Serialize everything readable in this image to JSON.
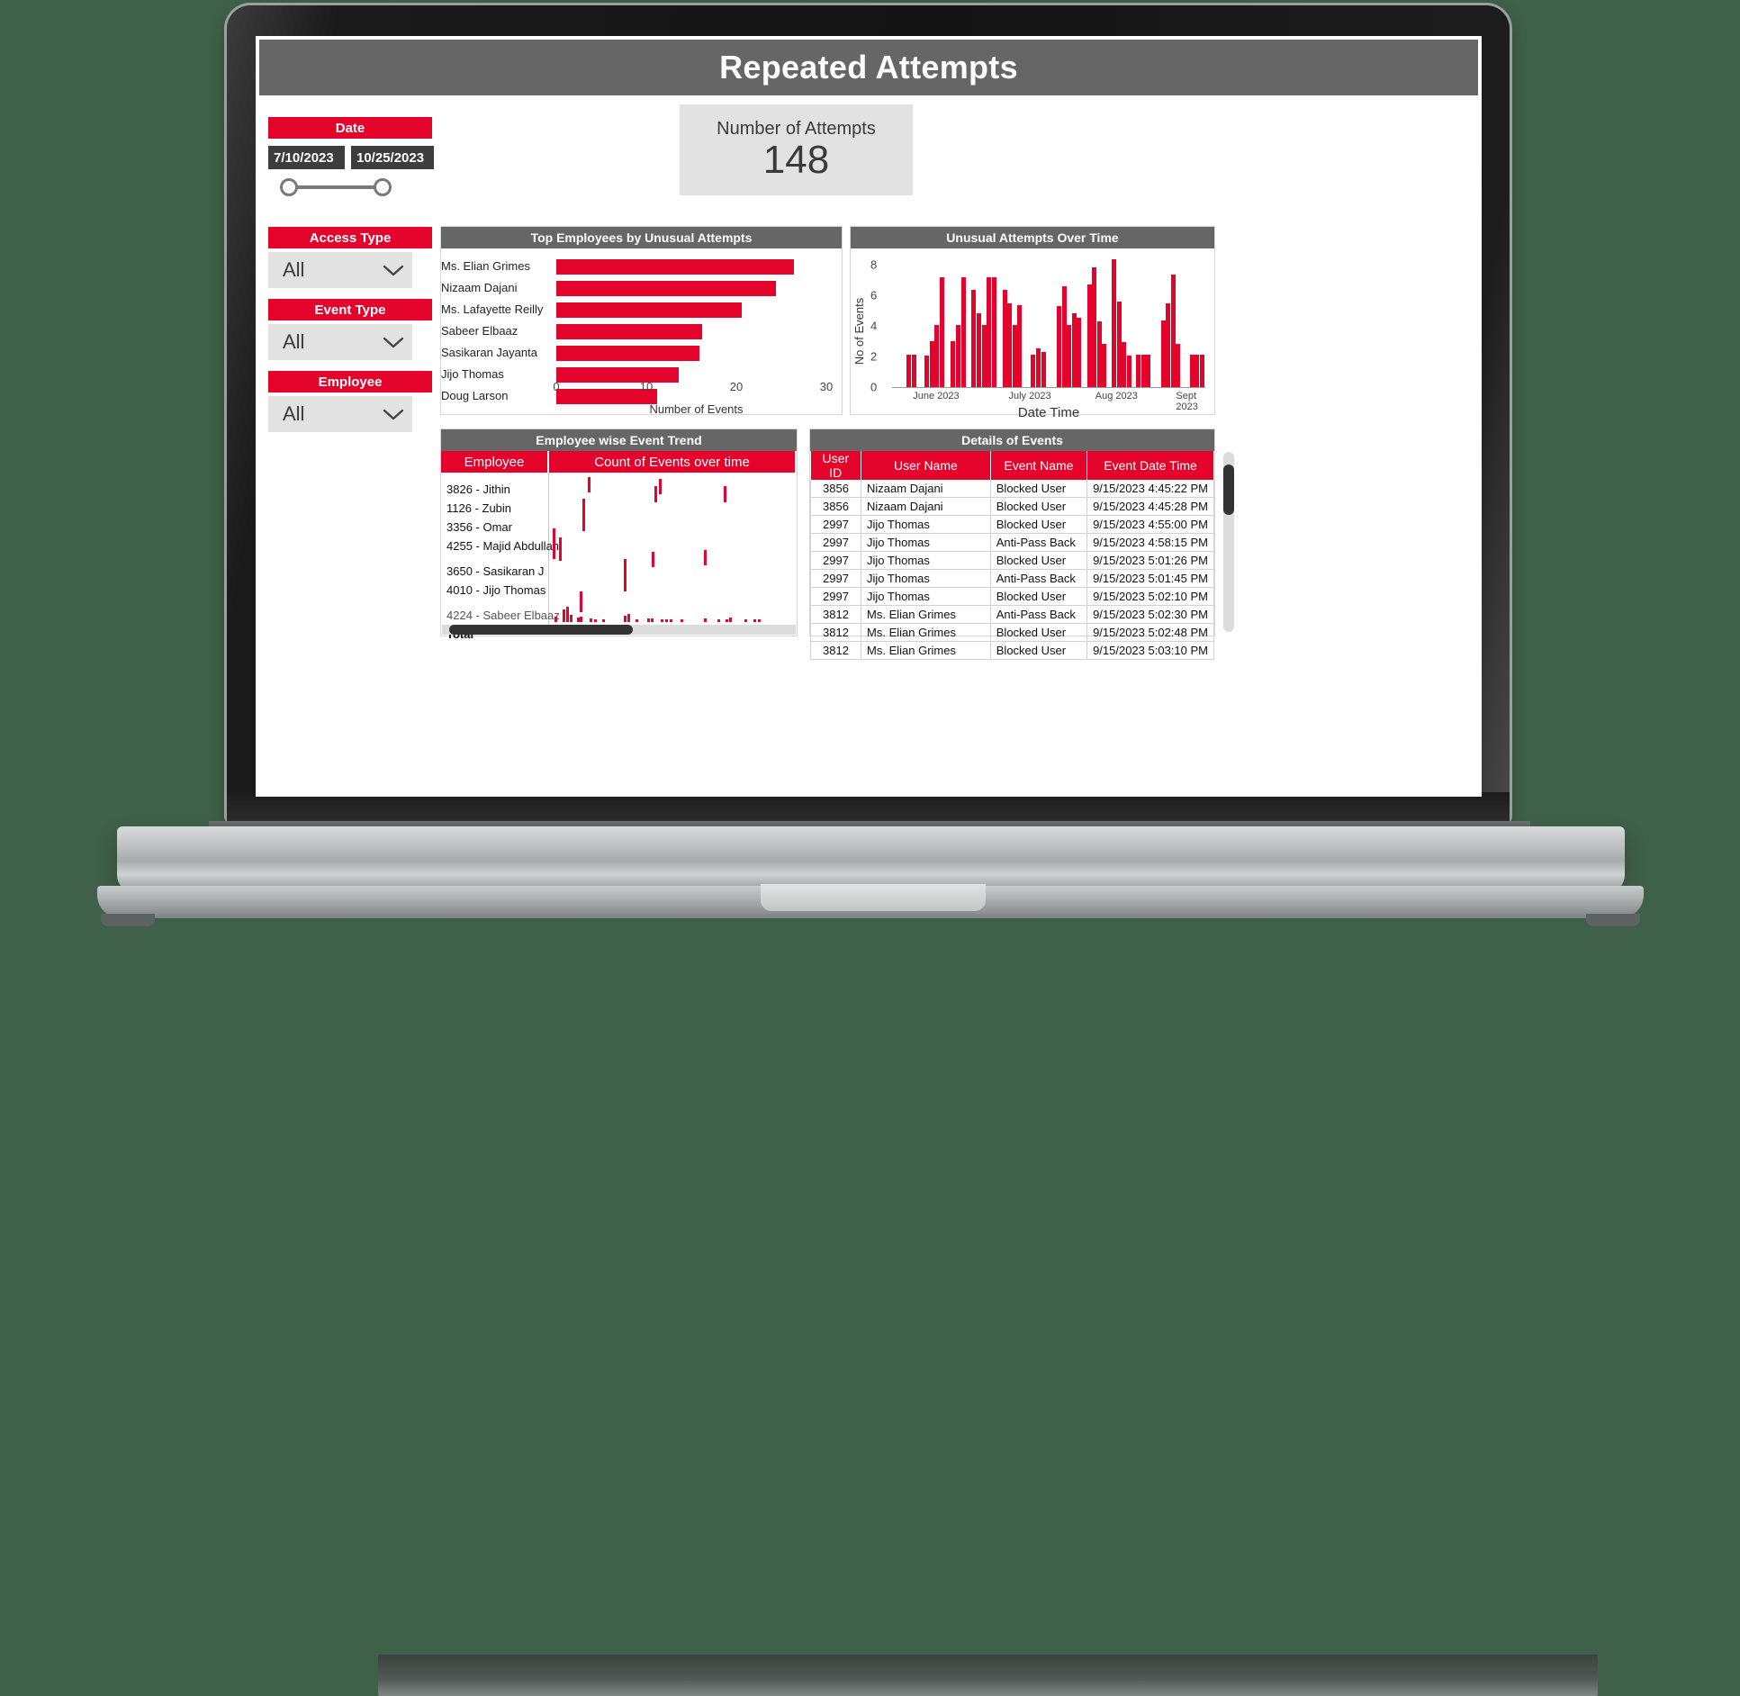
{
  "report": {
    "title": "Repeated Attempts",
    "header_bg": "#666666",
    "accent": "#E4032B"
  },
  "slicers": {
    "date": {
      "label": "Date",
      "start": "7/10/2023",
      "end": "10/25/2023",
      "start_icon": "calendar-icon",
      "end_icon": "calendar-icon"
    },
    "access_type": {
      "label": "Access Type",
      "value": "All",
      "icon": "chevron-down-icon"
    },
    "event_type": {
      "label": "Event Type",
      "value": "All",
      "icon": "chevron-down-icon"
    },
    "employee": {
      "label": "Employee",
      "value": "All",
      "icon": "chevron-down-icon"
    }
  },
  "kpi": {
    "label": "Number of Attempts",
    "value": "148"
  },
  "panels": {
    "top_employees": "Top Employees by Unusual Attempts",
    "over_time": "Unusual Attempts Over Time",
    "employee_trend": "Employee wise Event Trend",
    "details": "Details of Events"
  },
  "chart_data": [
    {
      "type": "bar",
      "orientation": "horizontal",
      "title": "Top Employees by Unusual Attempts",
      "xlabel": "Number of Events",
      "ylabel": "",
      "xlim": [
        0,
        30
      ],
      "xticks": [
        0,
        10,
        20,
        30
      ],
      "grid": false,
      "categories": [
        "Ms. Elian Grimes",
        "Nizaam Dajani",
        "Ms. Lafayette Reilly",
        "Sabeer Elbaaz",
        "Sasikaran Jayanta",
        "Jijo Thomas",
        "Doug Larson"
      ],
      "values": [
        26.4,
        24.4,
        20.6,
        16.2,
        15.9,
        13.6,
        11.2
      ],
      "color": "#E4032B"
    },
    {
      "type": "bar",
      "orientation": "vertical",
      "title": "Unusual Attempts Over Time",
      "xlabel": "Date Time",
      "ylabel": "No of Events",
      "ylim": [
        0,
        8.6
      ],
      "yticks": [
        0,
        2,
        4,
        6,
        8
      ],
      "xticks": [
        "June 2023",
        "July 2023",
        "Aug 2023",
        "Sept 2023"
      ],
      "xtick_positions": [
        0.07,
        0.39,
        0.68,
        0.95
      ],
      "grid": false,
      "color": "#E4032B",
      "values": [
        {
          "x": 0.055,
          "y": 2.1
        },
        {
          "x": 0.075,
          "y": 2.1
        },
        {
          "x": 0.125,
          "y": 2.05
        },
        {
          "x": 0.145,
          "y": 3.0
        },
        {
          "x": 0.163,
          "y": 4.05
        },
        {
          "x": 0.183,
          "y": 7.2
        },
        {
          "x": 0.225,
          "y": 3.0
        },
        {
          "x": 0.245,
          "y": 4.05
        },
        {
          "x": 0.265,
          "y": 7.2
        },
        {
          "x": 0.305,
          "y": 6.35
        },
        {
          "x": 0.325,
          "y": 4.85
        },
        {
          "x": 0.345,
          "y": 4.05
        },
        {
          "x": 0.363,
          "y": 7.2
        },
        {
          "x": 0.382,
          "y": 7.2
        },
        {
          "x": 0.423,
          "y": 6.35
        },
        {
          "x": 0.443,
          "y": 5.45
        },
        {
          "x": 0.462,
          "y": 4.05
        },
        {
          "x": 0.481,
          "y": 5.35
        },
        {
          "x": 0.531,
          "y": 2.1
        },
        {
          "x": 0.551,
          "y": 2.55
        },
        {
          "x": 0.571,
          "y": 2.3
        },
        {
          "x": 0.631,
          "y": 5.3
        },
        {
          "x": 0.65,
          "y": 6.6
        },
        {
          "x": 0.669,
          "y": 4.05
        },
        {
          "x": 0.688,
          "y": 4.85
        },
        {
          "x": 0.707,
          "y": 4.55
        },
        {
          "x": 0.747,
          "y": 6.7
        },
        {
          "x": 0.766,
          "y": 7.85
        },
        {
          "x": 0.785,
          "y": 4.3
        },
        {
          "x": 0.804,
          "y": 2.8
        },
        {
          "x": 0.843,
          "y": 8.35
        },
        {
          "x": 0.862,
          "y": 5.6
        },
        {
          "x": 0.881,
          "y": 2.95
        },
        {
          "x": 0.9,
          "y": 2.05
        },
        {
          "x": 0.936,
          "y": 2.15
        },
        {
          "x": 0.955,
          "y": 2.15
        },
        {
          "x": 0.974,
          "y": 2.15
        },
        {
          "x": 1.03,
          "y": 4.35
        },
        {
          "x": 1.049,
          "y": 5.45
        },
        {
          "x": 1.068,
          "y": 7.35
        },
        {
          "x": 1.087,
          "y": 2.8
        },
        {
          "x": 1.14,
          "y": 2.15
        },
        {
          "x": 1.159,
          "y": 2.15
        },
        {
          "x": 1.178,
          "y": 2.15
        }
      ]
    },
    {
      "type": "table",
      "title": "Employee wise Event Trend",
      "columns": [
        "Employee",
        "Count of Events over time"
      ],
      "rows": [
        "3826 - Jithin",
        "1126 - Zubin",
        "3356 - Omar",
        "4255 - Majid Abdullah",
        "3650 - Sasikaran J",
        "4010 - Jijo Thomas",
        "4224 - Sabeer Elbaaz",
        "Total"
      ],
      "sparklines": [
        {
          "x": 0.155,
          "y": 0.03,
          "h": 0.1
        },
        {
          "x": 0.445,
          "y": 0.04,
          "h": 0.1
        },
        {
          "x": 0.425,
          "y": 0.09,
          "h": 0.1
        },
        {
          "x": 0.705,
          "y": 0.09,
          "h": 0.1
        },
        {
          "x": 0.135,
          "y": 0.17,
          "h": 0.21
        },
        {
          "x": 0.015,
          "y": 0.36,
          "h": 0.2
        },
        {
          "x": 0.04,
          "y": 0.42,
          "h": 0.15
        },
        {
          "x": 0.415,
          "y": 0.51,
          "h": 0.1
        },
        {
          "x": 0.625,
          "y": 0.5,
          "h": 0.1
        },
        {
          "x": 0.3,
          "y": 0.56,
          "h": 0.21
        },
        {
          "x": 0.125,
          "y": 0.77,
          "h": 0.13
        }
      ]
    }
  ],
  "details_table": {
    "title": "Details of Events",
    "columns": [
      "User ID",
      "User Name",
      "Event Name",
      "Event Date Time"
    ],
    "rows": [
      [
        "3856",
        "Nizaam Dajani",
        "Blocked User",
        "9/15/2023 4:45:22 PM"
      ],
      [
        "3856",
        "Nizaam Dajani",
        "Blocked User",
        "9/15/2023 4:45:28 PM"
      ],
      [
        "2997",
        "Jijo Thomas",
        "Blocked User",
        "9/15/2023 4:55:00 PM"
      ],
      [
        "2997",
        "Jijo Thomas",
        "Anti-Pass Back",
        "9/15/2023 4:58:15 PM"
      ],
      [
        "2997",
        "Jijo Thomas",
        "Blocked User",
        "9/15/2023 5:01:26 PM"
      ],
      [
        "2997",
        "Jijo Thomas",
        "Anti-Pass Back",
        "9/15/2023 5:01:45 PM"
      ],
      [
        "2997",
        "Jijo Thomas",
        "Blocked User",
        "9/15/2023 5:02:10 PM"
      ],
      [
        "3812",
        "Ms. Elian Grimes",
        "Anti-Pass Back",
        "9/15/2023 5:02:30 PM"
      ],
      [
        "3812",
        "Ms. Elian Grimes",
        "Blocked User",
        "9/15/2023 5:02:48 PM"
      ],
      [
        "3812",
        "Ms. Elian Grimes",
        "Blocked User",
        "9/15/2023 5:03:10 PM"
      ]
    ]
  }
}
